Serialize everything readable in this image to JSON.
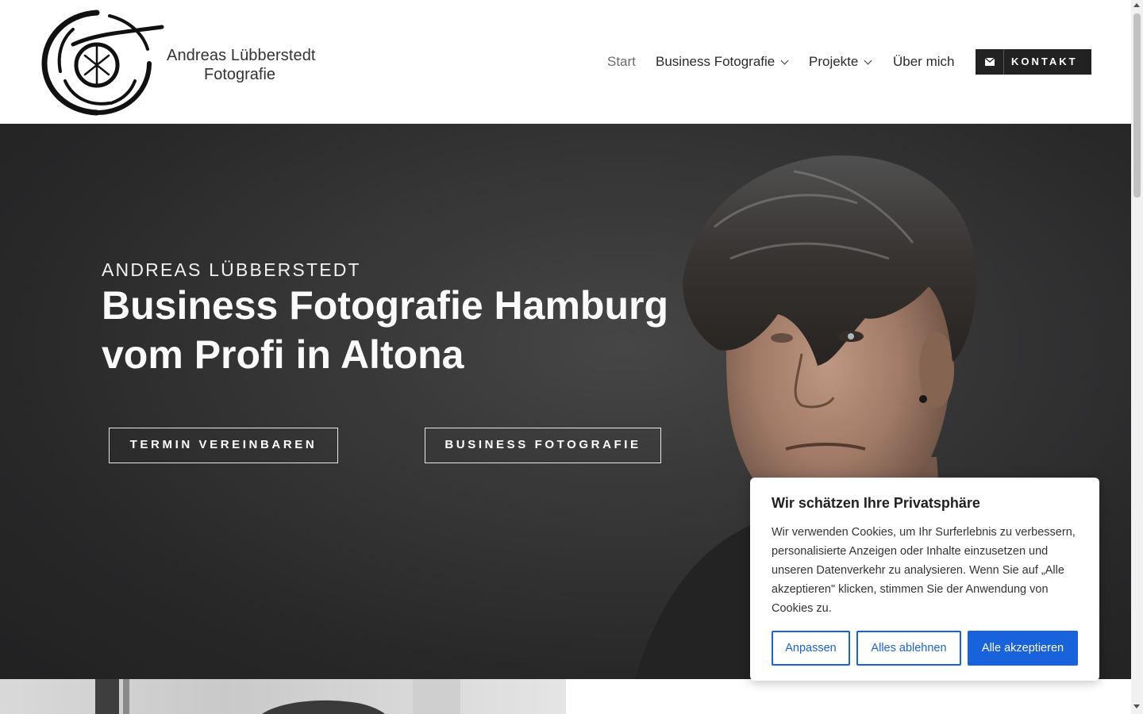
{
  "header": {
    "logo": {
      "line1": "Andreas Lübberstedt",
      "line2": "Fotografie"
    },
    "nav": [
      {
        "label": "Start",
        "active": true,
        "dropdown": false
      },
      {
        "label": "Business Fotografie",
        "active": false,
        "dropdown": true
      },
      {
        "label": "Projekte",
        "active": false,
        "dropdown": true
      },
      {
        "label": "Über mich",
        "active": false,
        "dropdown": false
      }
    ],
    "contact": {
      "label": "KONTAKT",
      "icon": "envelope-icon"
    }
  },
  "hero": {
    "kicker": "ANDREAS LÜBBERSTEDT",
    "title_line1": "Business Fotografie Hamburg",
    "title_line2": "vom Profi in Altona",
    "buttons": [
      "TERMIN VEREINBAREN",
      "BUSINESS FOTOGRAFIE"
    ]
  },
  "cookie_banner": {
    "title": "Wir schätzen Ihre Privatsphäre",
    "text": "Wir verwenden Cookies, um Ihr Surferlebnis zu verbessern, personalisierte Anzeigen oder Inhalte einzusetzen und unseren Datenverkehr zu analysieren. Wenn Sie auf „Alle akzeptieren\" klicken, stimmen Sie der Anwendung von Cookies zu.",
    "buttons": {
      "customize": "Anpassen",
      "reject": "Alles ablehnen",
      "accept": "Alle akzeptieren"
    }
  },
  "colors": {
    "accent_blue": "#1863dc",
    "hero_bg": "#2f2f30",
    "contact_bg": "#222222"
  }
}
